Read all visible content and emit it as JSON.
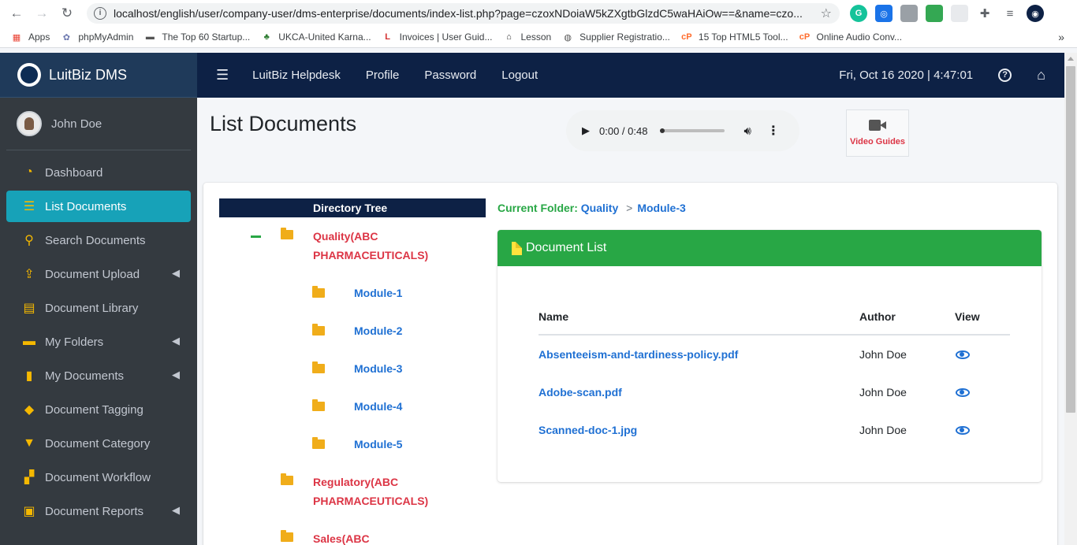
{
  "browser": {
    "url": "localhost/english/user/company-user/dms-enterprise/documents/index-list.php?page=czoxNDoiaW5kZXgtbGlzdC5waHAiOw==&name=czo...",
    "bookmarks": [
      {
        "label": "Apps",
        "icon": "apps-grid-icon"
      },
      {
        "label": "phpMyAdmin",
        "icon": "phpmyadmin-icon"
      },
      {
        "label": "The Top 60 Startup...",
        "icon": "startup-icon"
      },
      {
        "label": "UKCA-United Karna...",
        "icon": "ukca-icon"
      },
      {
        "label": "Invoices | User Guid...",
        "icon": "invoices-icon"
      },
      {
        "label": "Lesson",
        "icon": "lesson-icon"
      },
      {
        "label": "Supplier Registratio...",
        "icon": "globe-icon"
      },
      {
        "label": "15 Top HTML5 Tool...",
        "icon": "cpanel-icon"
      },
      {
        "label": "Online Audio Conv...",
        "icon": "cpanel-icon"
      }
    ],
    "more_bookmarks": "»"
  },
  "brand": {
    "name": "LuitBiz DMS"
  },
  "topbar": {
    "nav": [
      "LuitBiz Helpdesk",
      "Profile",
      "Password",
      "Logout"
    ],
    "datetime": "Fri, Oct 16 2020 | 4:47:01"
  },
  "sidebar": {
    "user_name": "John Doe",
    "items": [
      {
        "label": "Dashboard",
        "icon": "dashboard-icon",
        "active": false,
        "caret": false
      },
      {
        "label": "List Documents",
        "icon": "list-icon",
        "active": true,
        "caret": false
      },
      {
        "label": "Search Documents",
        "icon": "search-icon",
        "active": false,
        "caret": false
      },
      {
        "label": "Document Upload",
        "icon": "upload-icon",
        "active": false,
        "caret": true
      },
      {
        "label": "Document Library",
        "icon": "archive-icon",
        "active": false,
        "caret": false
      },
      {
        "label": "My Folders",
        "icon": "folder-icon",
        "active": false,
        "caret": true
      },
      {
        "label": "My Documents",
        "icon": "file-icon",
        "active": false,
        "caret": true
      },
      {
        "label": "Document Tagging",
        "icon": "tag-icon",
        "active": false,
        "caret": false
      },
      {
        "label": "Document Category",
        "icon": "bookmark-icon",
        "active": false,
        "caret": false
      },
      {
        "label": "Document Workflow",
        "icon": "sitemap-icon",
        "active": false,
        "caret": false
      },
      {
        "label": "Document Reports",
        "icon": "clipboard-icon",
        "active": false,
        "caret": true
      }
    ]
  },
  "page": {
    "title": "List Documents",
    "audio": {
      "time": "0:00 / 0:48"
    },
    "video_guides": "Video Guides"
  },
  "tree": {
    "header": "Directory Tree",
    "root": "Quality(ABC PHARMACEUTICALS)",
    "modules": [
      "Module-1",
      "Module-2",
      "Module-3",
      "Module-4",
      "Module-5"
    ],
    "others": [
      "Regulatory(ABC PHARMACEUTICALS)",
      "Sales(ABC"
    ]
  },
  "breadcrumb": {
    "label": "Current Folder:",
    "root": "Quality",
    "separator": ">",
    "current": "Module-3"
  },
  "documents": {
    "title": "Document List",
    "headers": [
      "Name",
      "Author",
      "View"
    ],
    "rows": [
      {
        "name": "Absenteeism-and-tardiness-policy.pdf",
        "author": "John Doe"
      },
      {
        "name": "Adobe-scan.pdf",
        "author": "John Doe"
      },
      {
        "name": "Scanned-doc-1.jpg",
        "author": "John Doe"
      }
    ]
  }
}
